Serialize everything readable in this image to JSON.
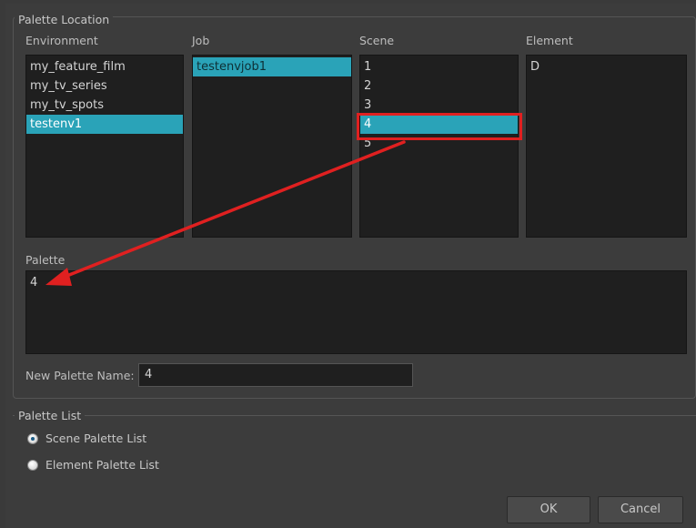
{
  "palette_location": {
    "title": "Palette Location",
    "environment": {
      "label": "Environment",
      "items": [
        "my_feature_film",
        "my_tv_series",
        "my_tv_spots",
        "testenv1"
      ],
      "selected": "testenv1"
    },
    "job": {
      "label": "Job",
      "items": [
        "testenvjob1"
      ],
      "selected": "testenvjob1"
    },
    "scene": {
      "label": "Scene",
      "items": [
        "1",
        "2",
        "3",
        "4",
        "5"
      ],
      "selected": "4"
    },
    "element": {
      "label": "Element",
      "items": [
        "D"
      ]
    },
    "palette": {
      "label": "Palette",
      "items": [
        "4"
      ]
    },
    "new_palette_name": {
      "label": "New Palette Name:",
      "value": "4"
    }
  },
  "palette_list": {
    "title": "Palette List",
    "options": [
      {
        "label": "Scene Palette List",
        "checked": true
      },
      {
        "label": "Element Palette List",
        "checked": false
      }
    ]
  },
  "buttons": {
    "ok": "OK",
    "cancel": "Cancel"
  },
  "colors": {
    "selection": "#2aa3b8",
    "annotation": "#e02020"
  }
}
